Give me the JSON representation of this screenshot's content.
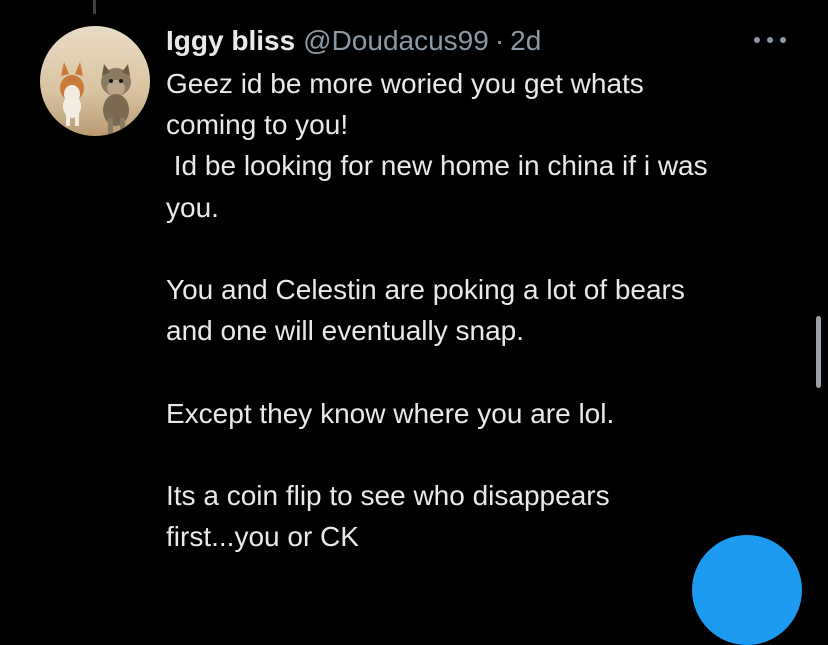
{
  "tweet": {
    "display_name": "Iggy bliss",
    "handle": "@Doudacus99",
    "separator": "·",
    "time": "2d",
    "lines": [
      "Geez id be more woried you get whats",
      "coming to you!",
      " Id be looking for new home in china if i was",
      "you.",
      "",
      "You and Celestin are poking a lot of bears",
      "and one will eventually snap.",
      "",
      "Except they know where you are lol.",
      "",
      "Its a coin flip to see who disappears",
      "first...you or CK"
    ]
  },
  "icons": {
    "more": "more-options-icon",
    "avatar": "avatar-image",
    "compose": "compose-fab-icon"
  },
  "colors": {
    "background": "#000000",
    "text_primary": "#e7e9ea",
    "text_secondary": "#8b98a5",
    "accent": "#1d9bf0"
  }
}
